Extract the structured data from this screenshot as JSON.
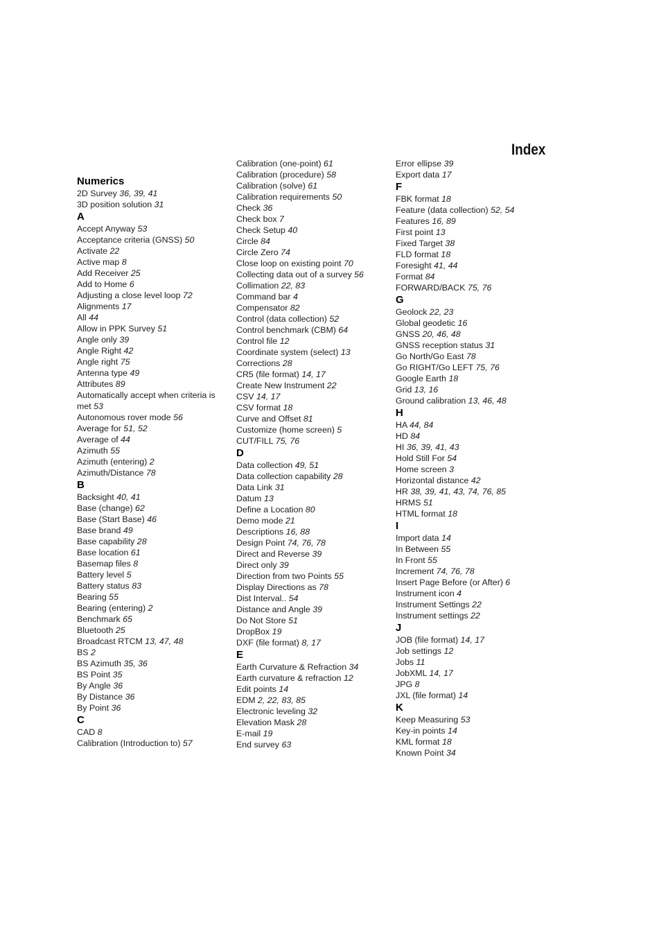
{
  "page_title": "Index",
  "columns": [
    [
      {
        "type": "heading",
        "text": "Numerics"
      },
      {
        "type": "entry",
        "term": "2D Survey",
        "pages": "36, 39, 41"
      },
      {
        "type": "entry",
        "term": "3D position solution",
        "pages": "31"
      },
      {
        "type": "heading",
        "text": "A"
      },
      {
        "type": "entry",
        "term": "Accept Anyway",
        "pages": "53"
      },
      {
        "type": "entry",
        "term": "Acceptance criteria (GNSS)",
        "pages": "50"
      },
      {
        "type": "entry",
        "term": "Activate",
        "pages": "22"
      },
      {
        "type": "entry",
        "term": "Active map",
        "pages": "8"
      },
      {
        "type": "entry",
        "term": "Add Receiver",
        "pages": "25"
      },
      {
        "type": "entry",
        "term": "Add to Home",
        "pages": "6"
      },
      {
        "type": "entry",
        "term": "Adjusting a close level loop",
        "pages": "72"
      },
      {
        "type": "entry",
        "term": "Alignments",
        "pages": "17"
      },
      {
        "type": "entry",
        "term": "All",
        "pages": "44"
      },
      {
        "type": "entry",
        "term": "Allow in PPK Survey",
        "pages": "51"
      },
      {
        "type": "entry",
        "term": "Angle only",
        "pages": "39"
      },
      {
        "type": "entry",
        "term": "Angle Right",
        "pages": "42"
      },
      {
        "type": "entry",
        "term": "Angle right",
        "pages": "75"
      },
      {
        "type": "entry",
        "term": "Antenna type",
        "pages": "49"
      },
      {
        "type": "entry",
        "term": "Attributes",
        "pages": "89"
      },
      {
        "type": "entry",
        "term": "Automatically accept when criteria is met",
        "pages": "53",
        "wrap": true
      },
      {
        "type": "entry",
        "term": "Autonomous rover mode",
        "pages": "56"
      },
      {
        "type": "entry",
        "term": "Average for",
        "pages": "51, 52"
      },
      {
        "type": "entry",
        "term": "Average of",
        "pages": "44"
      },
      {
        "type": "entry",
        "term": "Azimuth",
        "pages": "55"
      },
      {
        "type": "entry",
        "term": "Azimuth (entering)",
        "pages": "2"
      },
      {
        "type": "entry",
        "term": "Azimuth/Distance",
        "pages": "78"
      },
      {
        "type": "heading",
        "text": "B"
      },
      {
        "type": "entry",
        "term": "Backsight",
        "pages": "40, 41"
      },
      {
        "type": "entry",
        "term": "Base (change)",
        "pages": "62"
      },
      {
        "type": "entry",
        "term": "Base (Start Base)",
        "pages": "46"
      },
      {
        "type": "entry",
        "term": "Base brand",
        "pages": "49"
      },
      {
        "type": "entry",
        "term": "Base capability",
        "pages": "28"
      },
      {
        "type": "entry",
        "term": "Base location",
        "pages": "61"
      },
      {
        "type": "entry",
        "term": "Basemap files",
        "pages": "8"
      },
      {
        "type": "entry",
        "term": "Battery level",
        "pages": "5"
      },
      {
        "type": "entry",
        "term": "Battery status",
        "pages": "83"
      },
      {
        "type": "entry",
        "term": "Bearing",
        "pages": "55"
      },
      {
        "type": "entry",
        "term": "Bearing (entering)",
        "pages": "2"
      },
      {
        "type": "entry",
        "term": "Benchmark",
        "pages": "65"
      },
      {
        "type": "entry",
        "term": "Bluetooth",
        "pages": "25"
      },
      {
        "type": "entry",
        "term": "Broadcast RTCM",
        "pages": "13, 47, 48"
      },
      {
        "type": "entry",
        "term": "BS",
        "pages": "2"
      },
      {
        "type": "entry",
        "term": "BS Azimuth",
        "pages": "35, 36"
      },
      {
        "type": "entry",
        "term": "BS Point",
        "pages": "35"
      },
      {
        "type": "entry",
        "term": "By Angle",
        "pages": "36"
      },
      {
        "type": "entry",
        "term": "By Distance",
        "pages": "36"
      },
      {
        "type": "entry",
        "term": "By Point",
        "pages": "36"
      },
      {
        "type": "heading",
        "text": "C"
      },
      {
        "type": "entry",
        "term": "CAD",
        "pages": "8"
      },
      {
        "type": "entry",
        "term": "Calibration (Introduction to)",
        "pages": "57"
      }
    ],
    [
      {
        "type": "entry",
        "term": "Calibration (one-point)",
        "pages": "61"
      },
      {
        "type": "entry",
        "term": "Calibration (procedure)",
        "pages": "58"
      },
      {
        "type": "entry",
        "term": "Calibration (solve)",
        "pages": "61"
      },
      {
        "type": "entry",
        "term": "Calibration requirements",
        "pages": "50"
      },
      {
        "type": "entry",
        "term": "Check",
        "pages": "36"
      },
      {
        "type": "entry",
        "term": "Check box",
        "pages": "7"
      },
      {
        "type": "entry",
        "term": "Check Setup",
        "pages": "40"
      },
      {
        "type": "entry",
        "term": "Circle",
        "pages": "84"
      },
      {
        "type": "entry",
        "term": "Circle Zero",
        "pages": "74"
      },
      {
        "type": "entry",
        "term": "Close loop on existing point",
        "pages": "70"
      },
      {
        "type": "entry",
        "term": "Collecting data out of a survey",
        "pages": "56"
      },
      {
        "type": "entry",
        "term": "Collimation",
        "pages": "22, 83"
      },
      {
        "type": "entry",
        "term": "Command bar",
        "pages": "4"
      },
      {
        "type": "entry",
        "term": "Compensator",
        "pages": "82"
      },
      {
        "type": "entry",
        "term": "Control (data collection)",
        "pages": "52"
      },
      {
        "type": "entry",
        "term": "Control benchmark (CBM)",
        "pages": "64"
      },
      {
        "type": "entry",
        "term": "Control file",
        "pages": "12"
      },
      {
        "type": "entry",
        "term": "Coordinate system (select)",
        "pages": "13"
      },
      {
        "type": "entry",
        "term": "Corrections",
        "pages": "28"
      },
      {
        "type": "entry",
        "term": "CR5 (file format)",
        "pages": "14, 17"
      },
      {
        "type": "entry",
        "term": "Create New Instrument",
        "pages": "22"
      },
      {
        "type": "entry",
        "term": "CSV",
        "pages": "14, 17"
      },
      {
        "type": "entry",
        "term": "CSV format",
        "pages": "18"
      },
      {
        "type": "entry",
        "term": "Curve and Offset",
        "pages": "81"
      },
      {
        "type": "entry",
        "term": "Customize (home screen)",
        "pages": "5"
      },
      {
        "type": "entry",
        "term": "CUT/FILL",
        "pages": "75, 76"
      },
      {
        "type": "heading",
        "text": "D"
      },
      {
        "type": "entry",
        "term": "Data collection",
        "pages": "49, 51"
      },
      {
        "type": "entry",
        "term": "Data collection capability",
        "pages": "28"
      },
      {
        "type": "entry",
        "term": "Data Link",
        "pages": "31"
      },
      {
        "type": "entry",
        "term": "Datum",
        "pages": "13"
      },
      {
        "type": "entry",
        "term": "Define a Location",
        "pages": "80"
      },
      {
        "type": "entry",
        "term": "Demo mode",
        "pages": "21"
      },
      {
        "type": "entry",
        "term": "Descriptions",
        "pages": "16, 88"
      },
      {
        "type": "entry",
        "term": "Design Point",
        "pages": "74, 76, 78"
      },
      {
        "type": "entry",
        "term": "Direct and Reverse",
        "pages": "39"
      },
      {
        "type": "entry",
        "term": "Direct only",
        "pages": "39"
      },
      {
        "type": "entry",
        "term": "Direction from two Points",
        "pages": "55"
      },
      {
        "type": "entry",
        "term": "Display Directions as",
        "pages": "78"
      },
      {
        "type": "entry",
        "term": "Dist Interval..",
        "pages": "54"
      },
      {
        "type": "entry",
        "term": "Distance and Angle",
        "pages": "39"
      },
      {
        "type": "entry",
        "term": "Do Not Store",
        "pages": "51"
      },
      {
        "type": "entry",
        "term": "DropBox",
        "pages": "19"
      },
      {
        "type": "entry",
        "term": "DXF (file format)",
        "pages": "8, 17"
      },
      {
        "type": "heading",
        "text": "E"
      },
      {
        "type": "entry",
        "term": "Earth Curvature & Refraction",
        "pages": "34"
      },
      {
        "type": "entry",
        "term": "Earth curvature & refraction",
        "pages": "12"
      },
      {
        "type": "entry",
        "term": "Edit points",
        "pages": "14"
      },
      {
        "type": "entry",
        "term": "EDM",
        "pages": "2, 22, 83, 85"
      },
      {
        "type": "entry",
        "term": "Electronic leveling",
        "pages": "32"
      },
      {
        "type": "entry",
        "term": "Elevation Mask",
        "pages": "28"
      },
      {
        "type": "entry",
        "term": "E-mail",
        "pages": "19"
      },
      {
        "type": "entry",
        "term": "End survey",
        "pages": "63"
      }
    ],
    [
      {
        "type": "entry",
        "term": "Error ellipse",
        "pages": "39"
      },
      {
        "type": "entry",
        "term": "Export data",
        "pages": "17"
      },
      {
        "type": "heading",
        "text": "F"
      },
      {
        "type": "entry",
        "term": "FBK format",
        "pages": "18"
      },
      {
        "type": "entry",
        "term": "Feature (data collection)",
        "pages": "52, 54"
      },
      {
        "type": "entry",
        "term": "Features",
        "pages": "16, 89"
      },
      {
        "type": "entry",
        "term": "First point",
        "pages": "13"
      },
      {
        "type": "entry",
        "term": "Fixed Target",
        "pages": "38"
      },
      {
        "type": "entry",
        "term": "FLD format",
        "pages": "18"
      },
      {
        "type": "entry",
        "term": "Foresight",
        "pages": "41, 44"
      },
      {
        "type": "entry",
        "term": "Format",
        "pages": "84"
      },
      {
        "type": "entry",
        "term": "FORWARD/BACK",
        "pages": "75, 76"
      },
      {
        "type": "heading",
        "text": "G"
      },
      {
        "type": "entry",
        "term": "Geolock",
        "pages": "22, 23"
      },
      {
        "type": "entry",
        "term": "Global geodetic",
        "pages": "16"
      },
      {
        "type": "entry",
        "term": "GNSS",
        "pages": "20, 46, 48"
      },
      {
        "type": "entry",
        "term": "GNSS reception status",
        "pages": "31"
      },
      {
        "type": "entry",
        "term": "Go North/Go East",
        "pages": "78"
      },
      {
        "type": "entry",
        "term": "Go RIGHT/Go LEFT",
        "pages": "75, 76"
      },
      {
        "type": "entry",
        "term": "Google Earth",
        "pages": "18"
      },
      {
        "type": "entry",
        "term": "Grid",
        "pages": "13, 16"
      },
      {
        "type": "entry",
        "term": "Ground calibration",
        "pages": "13, 46, 48"
      },
      {
        "type": "heading",
        "text": "H"
      },
      {
        "type": "entry",
        "term": "HA",
        "pages": "44, 84"
      },
      {
        "type": "entry",
        "term": "HD",
        "pages": "84"
      },
      {
        "type": "entry",
        "term": "HI",
        "pages": "36, 39, 41, 43"
      },
      {
        "type": "entry",
        "term": "Hold Still For",
        "pages": "54"
      },
      {
        "type": "entry",
        "term": "Home screen",
        "pages": "3"
      },
      {
        "type": "entry",
        "term": "Horizontal distance",
        "pages": "42"
      },
      {
        "type": "entry",
        "term": "HR",
        "pages": "38, 39, 41, 43, 74, 76, 85"
      },
      {
        "type": "entry",
        "term": "HRMS",
        "pages": "51"
      },
      {
        "type": "entry",
        "term": "HTML format",
        "pages": "18"
      },
      {
        "type": "heading",
        "text": "I"
      },
      {
        "type": "entry",
        "term": "Import data",
        "pages": "14"
      },
      {
        "type": "entry",
        "term": "In Between",
        "pages": "55"
      },
      {
        "type": "entry",
        "term": "In Front",
        "pages": "55"
      },
      {
        "type": "entry",
        "term": "Increment",
        "pages": "74, 76, 78"
      },
      {
        "type": "entry",
        "term": "Insert Page Before (or After)",
        "pages": "6"
      },
      {
        "type": "entry",
        "term": "Instrument icon",
        "pages": "4"
      },
      {
        "type": "entry",
        "term": "Instrument Settings",
        "pages": "22"
      },
      {
        "type": "entry",
        "term": "Instrument settings",
        "pages": "22"
      },
      {
        "type": "heading",
        "text": "J"
      },
      {
        "type": "entry",
        "term": "JOB (file format)",
        "pages": "14, 17"
      },
      {
        "type": "entry",
        "term": "Job settings",
        "pages": "12"
      },
      {
        "type": "entry",
        "term": "Jobs",
        "pages": "11"
      },
      {
        "type": "entry",
        "term": "JobXML",
        "pages": "14, 17"
      },
      {
        "type": "entry",
        "term": "JPG",
        "pages": "8"
      },
      {
        "type": "entry",
        "term": "JXL (file format)",
        "pages": "14"
      },
      {
        "type": "heading",
        "text": "K"
      },
      {
        "type": "entry",
        "term": "Keep Measuring",
        "pages": "53"
      },
      {
        "type": "entry",
        "term": "Key-in points",
        "pages": "14"
      },
      {
        "type": "entry",
        "term": "KML format",
        "pages": "18"
      },
      {
        "type": "entry",
        "term": "Known Point",
        "pages": "34"
      }
    ]
  ]
}
